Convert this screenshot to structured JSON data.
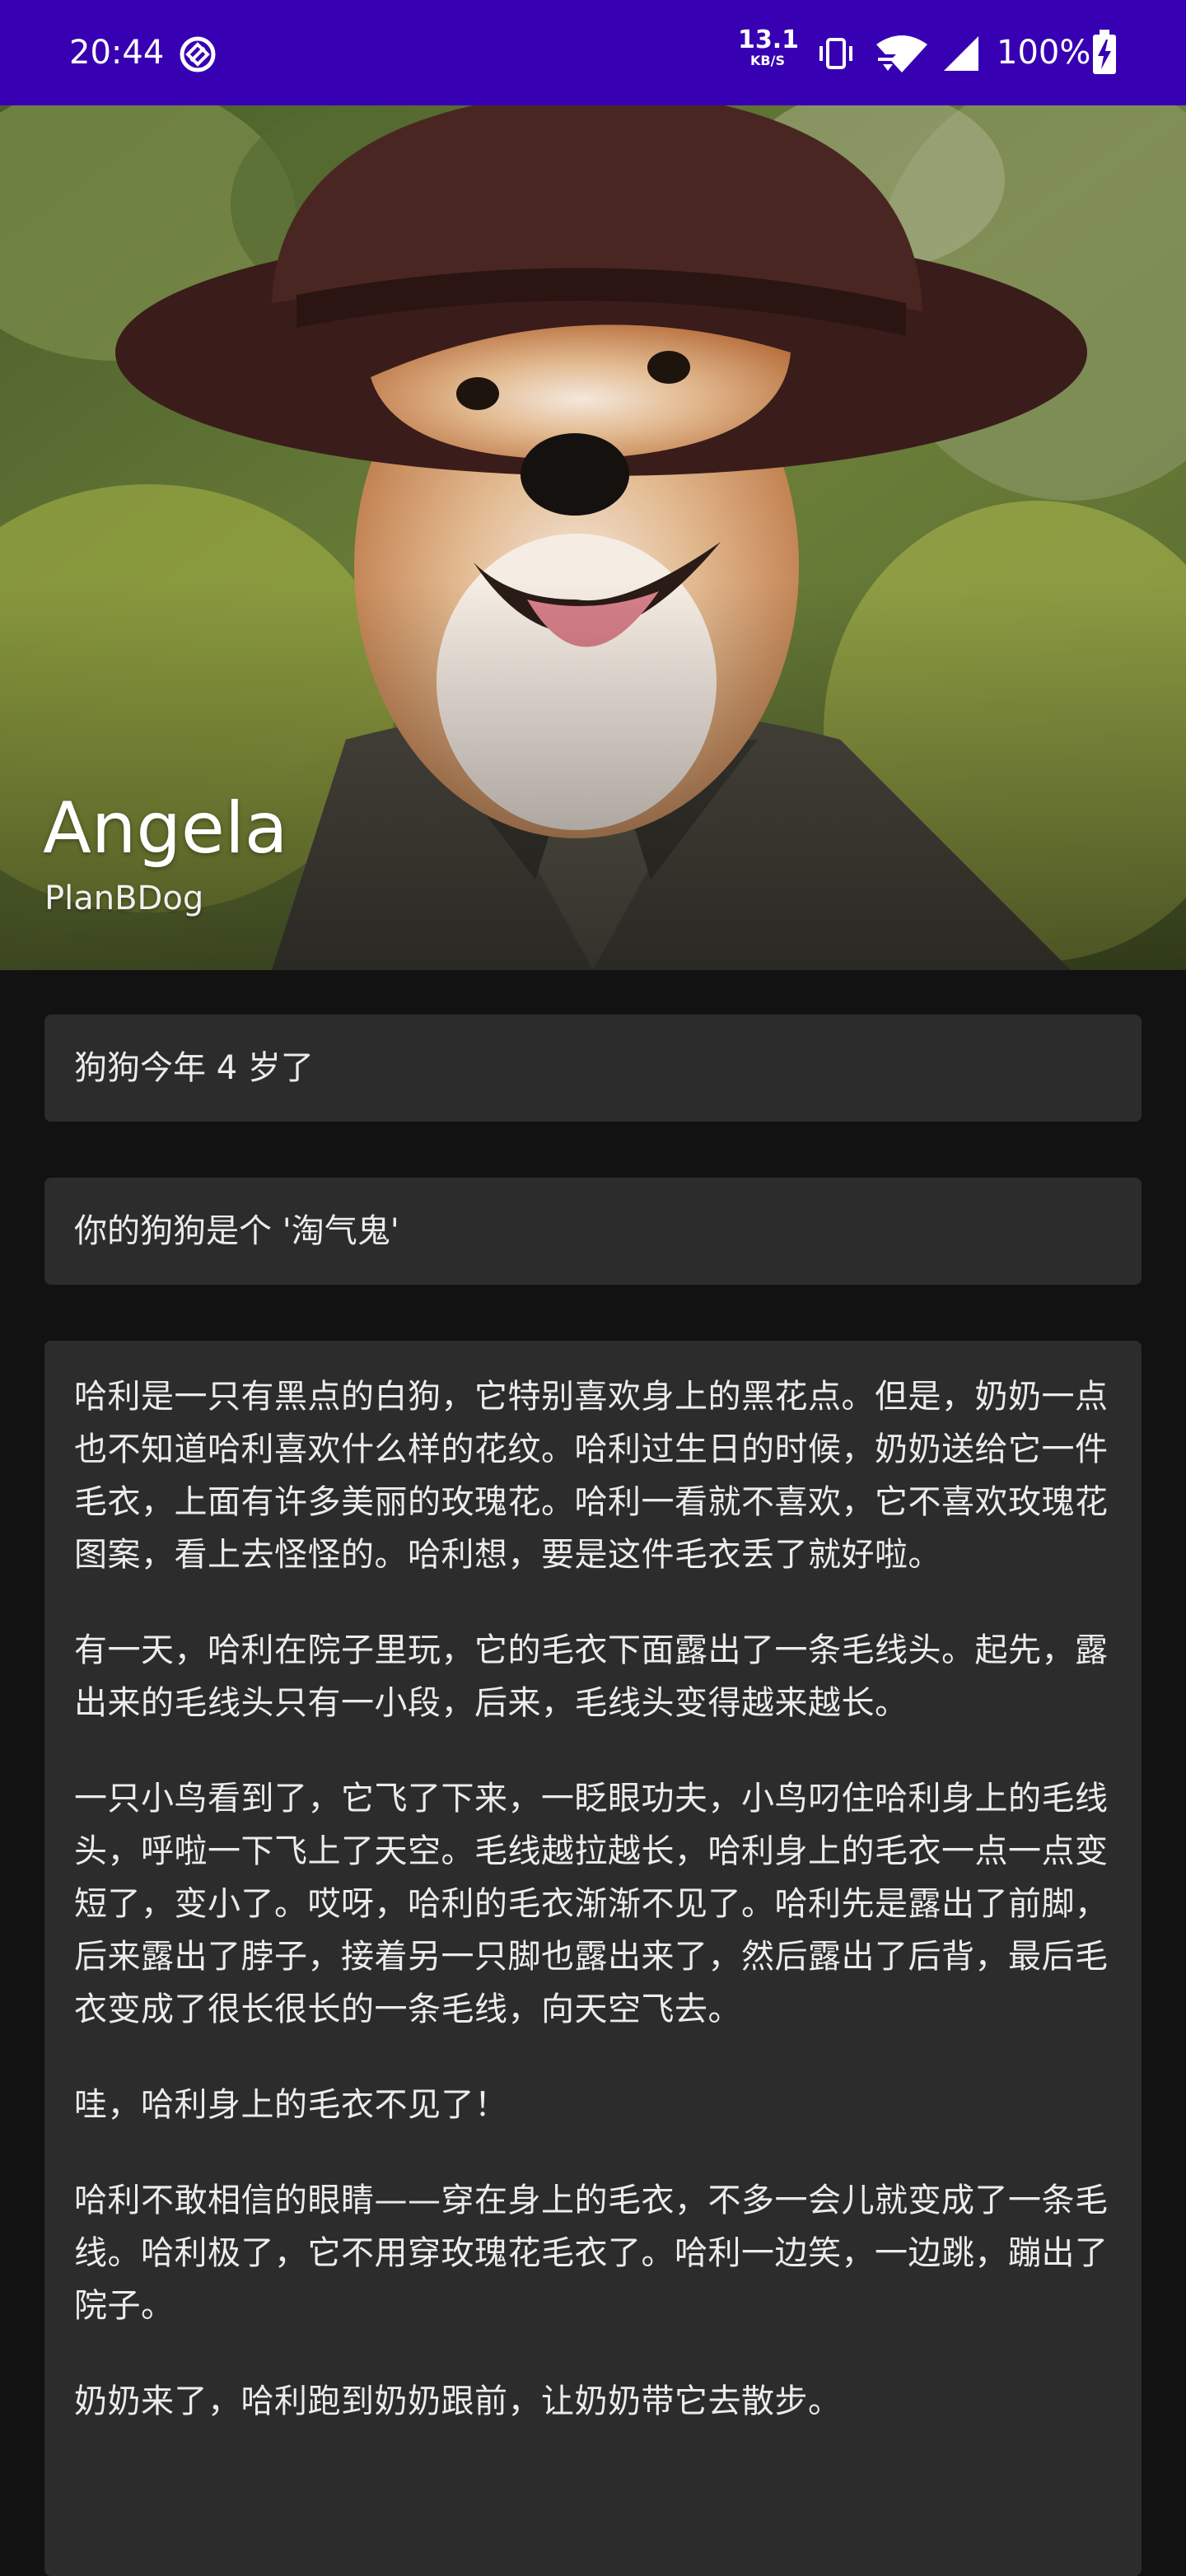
{
  "status_bar": {
    "time": "20:44",
    "net_speed_value": "13.1",
    "net_speed_unit": "KB/S",
    "battery": "100%",
    "icons": [
      "data-saver-icon",
      "vibrate-icon",
      "wifi-icon",
      "cell-signal-icon",
      "battery-charging-icon"
    ],
    "background": "#3700b3"
  },
  "header": {
    "title": "Angela",
    "subtitle": "PlanBDog",
    "image": "shiba-inu-dog-in-hat-photo"
  },
  "cards": {
    "age_text": "狗狗今年 4 岁了",
    "nature_text": "你的狗狗是个 '淘气鬼'",
    "story_paragraphs": [
      "哈利是一只有黑点的白狗，它特别喜欢身上的黑花点。但是，奶奶一点也不知道哈利喜欢什么样的花纹。哈利过生日的时候，奶奶送给它一件毛衣，上面有许多美丽的玫瑰花。哈利一看就不喜欢，它不喜欢玫瑰花图案，看上去怪怪的。哈利想，要是这件毛衣丢了就好啦。",
      "有一天，哈利在院子里玩，它的毛衣下面露出了一条毛线头。起先，露出来的毛线头只有一小段，后来，毛线头变得越来越长。",
      "一只小鸟看到了，它飞了下来，一眨眼功夫，小鸟叼住哈利身上的毛线头，呼啦一下飞上了天空。毛线越拉越长，哈利身上的毛衣一点一点变短了，变小了。哎呀，哈利的毛衣渐渐不见了。哈利先是露出了前脚，后来露出了脖子，接着另一只脚也露出来了，然后露出了后背，最后毛衣变成了很长很长的一条毛线，向天空飞去。",
      "哇，哈利身上的毛衣不见了！",
      "哈利不敢相信的眼睛——穿在身上的毛衣，不多一会儿就变成了一条毛线。哈利极了，它不用穿玫瑰花毛衣了。哈利一边笑，一边跳，蹦出了院子。",
      "奶奶来了，哈利跑到奶奶跟前，让奶奶带它去散步。"
    ],
    "card_background": "#2c2c2c",
    "page_background": "#121212"
  }
}
